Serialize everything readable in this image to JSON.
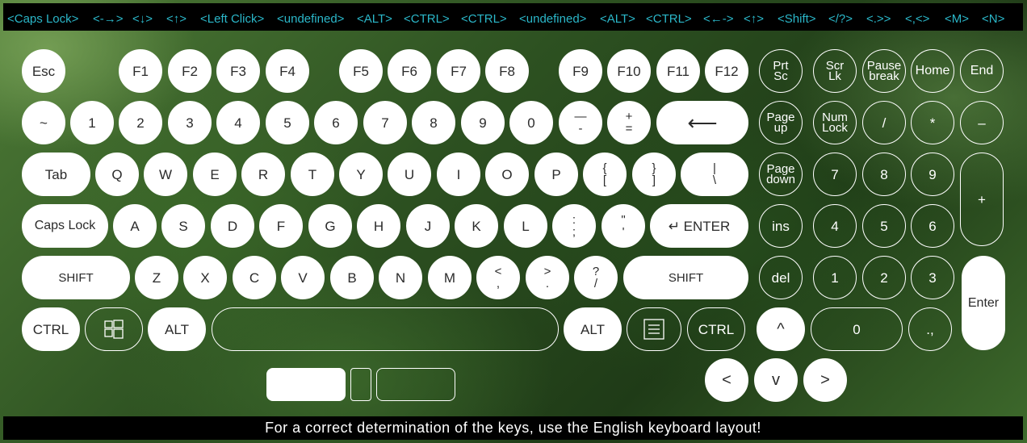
{
  "hotkeys": [
    "<Caps Lock>",
    "<-→>",
    "<↓>",
    "<↑>",
    "<Left Click>",
    "<undefined>",
    "<ALT>",
    "<CTRL>",
    "<CTRL>",
    "<undefined>",
    "<ALT>",
    "<CTRL>",
    "<←->",
    "<↑>",
    "<Shift>",
    "</?>",
    "<.>>",
    "<,<>",
    "<M>",
    "<N>"
  ],
  "footer": "For a correct determination of the keys, use the English keyboard layout!",
  "keys": {
    "esc": "Esc",
    "f1": "F1",
    "f2": "F2",
    "f3": "F3",
    "f4": "F4",
    "f5": "F5",
    "f6": "F6",
    "f7": "F7",
    "f8": "F8",
    "f9": "F9",
    "f10": "F10",
    "f11": "F11",
    "f12": "F12",
    "prtsc_1": "Prt",
    "prtsc_2": "Sc",
    "scrlk_1": "Scr",
    "scrlk_2": "Lk",
    "pause_1": "Pause",
    "pause_2": "break",
    "home": "Home",
    "end": "End",
    "tilde": "~",
    "d1": "1",
    "d2": "2",
    "d3": "3",
    "d4": "4",
    "d5": "5",
    "d6": "6",
    "d7": "7",
    "d8": "8",
    "d9": "9",
    "d0": "0",
    "minus_1": "—",
    "minus_2": "-",
    "plus_1": "+",
    "plus_2": "=",
    "backspace": "⟵",
    "pgup_1": "Page",
    "pgup_2": "up",
    "numlock_1": "Num",
    "numlock_2": "Lock",
    "np_div": "/",
    "np_mul": "*",
    "np_minus": "–",
    "tab": "Tab",
    "q": "Q",
    "w": "W",
    "e": "E",
    "r": "R",
    "t": "T",
    "y": "Y",
    "u": "U",
    "i": "I",
    "o": "O",
    "p": "P",
    "lbr_1": "{",
    "lbr_2": "[",
    "rbr_1": "}",
    "rbr_2": "]",
    "bsl_1": "|",
    "bsl_2": "\\",
    "pgdn_1": "Page",
    "pgdn_2": "down",
    "np7": "7",
    "np8": "8",
    "np9": "9",
    "np_plus": "+",
    "caps": "Caps Lock",
    "a": "A",
    "s": "S",
    "d": "D",
    "f": "F",
    "g": "G",
    "h": "H",
    "j": "J",
    "k": "K",
    "l": "L",
    "semi_1": ":",
    "semi_2": ";",
    "quote_1": "\"",
    "quote_2": "'",
    "enter": "↵ ENTER",
    "ins": "ins",
    "np4": "4",
    "np5": "5",
    "np6": "6",
    "lshift": "SHIFT",
    "z": "Z",
    "x": "X",
    "c": "C",
    "v": "V",
    "b": "B",
    "n": "N",
    "m": "M",
    "comma_1": "<",
    "comma_2": ",",
    "period_1": ">",
    "period_2": ".",
    "slash_1": "?",
    "slash_2": "/",
    "rshift": "SHIFT",
    "del": "del",
    "np1": "1",
    "np2": "2",
    "np3": "3",
    "np_enter": "Enter",
    "lctrl": "CTRL",
    "lalt": "ALT",
    "ralt": "ALT",
    "rctrl": "CTRL",
    "up": "^",
    "np0": "0",
    "np_dot": ".,",
    "left": "<",
    "down": "v",
    "right": ">"
  }
}
